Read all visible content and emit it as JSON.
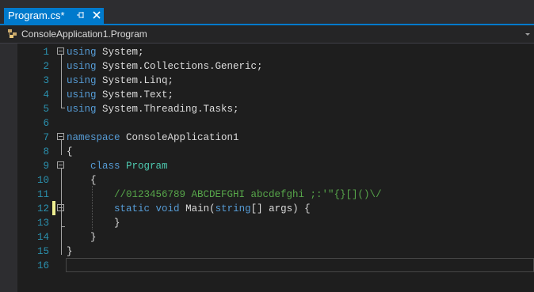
{
  "tab": {
    "title": "Program.cs*"
  },
  "navbar": {
    "scope": "ConsoleApplication1.Program"
  },
  "icons": {
    "pin": "pin-icon",
    "close": "close-icon",
    "class": "class-icon",
    "dropdown": "chevron-down-icon"
  },
  "colors": {
    "accent": "#007acc",
    "keyword": "#569cd6",
    "type": "#4ec9b0",
    "comment": "#57a64a",
    "line_number": "#2b91af",
    "text": "#dcdcdc",
    "editor_bg": "#1e1e1e",
    "change_marker": "#efef91"
  },
  "editor": {
    "line_numbers": [
      "1",
      "2",
      "3",
      "4",
      "5",
      "6",
      "7",
      "8",
      "9",
      "10",
      "11",
      "12",
      "13",
      "14",
      "15",
      "16"
    ],
    "lines": [
      {
        "segments": [
          {
            "text": "using",
            "kind": "kw"
          },
          {
            "text": " System;",
            "kind": "plain"
          }
        ]
      },
      {
        "segments": [
          {
            "text": "using",
            "kind": "kw"
          },
          {
            "text": " System.Collections.Generic;",
            "kind": "plain"
          }
        ]
      },
      {
        "segments": [
          {
            "text": "using",
            "kind": "kw"
          },
          {
            "text": " System.Linq;",
            "kind": "plain"
          }
        ]
      },
      {
        "segments": [
          {
            "text": "using",
            "kind": "kw"
          },
          {
            "text": " System.Text;",
            "kind": "plain"
          }
        ]
      },
      {
        "segments": [
          {
            "text": "using",
            "kind": "kw"
          },
          {
            "text": " System.Threading.Tasks;",
            "kind": "plain"
          }
        ]
      },
      {
        "segments": []
      },
      {
        "segments": [
          {
            "text": "namespace",
            "kind": "kw"
          },
          {
            "text": " ConsoleApplication1",
            "kind": "plain"
          }
        ]
      },
      {
        "segments": [
          {
            "text": "{",
            "kind": "plain"
          }
        ]
      },
      {
        "segments": [
          {
            "text": "    ",
            "kind": "plain"
          },
          {
            "text": "class",
            "kind": "kw"
          },
          {
            "text": " ",
            "kind": "plain"
          },
          {
            "text": "Program",
            "kind": "cls"
          }
        ]
      },
      {
        "segments": [
          {
            "text": "    {",
            "kind": "plain"
          }
        ]
      },
      {
        "segments": [
          {
            "text": "        //0123456789 ABCDEFGHI abcdefghi ;:'\"{}[]()\\/",
            "kind": "cm"
          }
        ]
      },
      {
        "segments": [
          {
            "text": "        ",
            "kind": "plain"
          },
          {
            "text": "static",
            "kind": "kw"
          },
          {
            "text": " ",
            "kind": "plain"
          },
          {
            "text": "void",
            "kind": "kw"
          },
          {
            "text": " Main(",
            "kind": "plain"
          },
          {
            "text": "string",
            "kind": "kw"
          },
          {
            "text": "[] args) {",
            "kind": "plain"
          }
        ]
      },
      {
        "segments": [
          {
            "text": "        }",
            "kind": "plain"
          }
        ]
      },
      {
        "segments": [
          {
            "text": "    }",
            "kind": "plain"
          }
        ]
      },
      {
        "segments": [
          {
            "text": "}",
            "kind": "plain"
          }
        ]
      },
      {
        "segments": []
      }
    ]
  }
}
